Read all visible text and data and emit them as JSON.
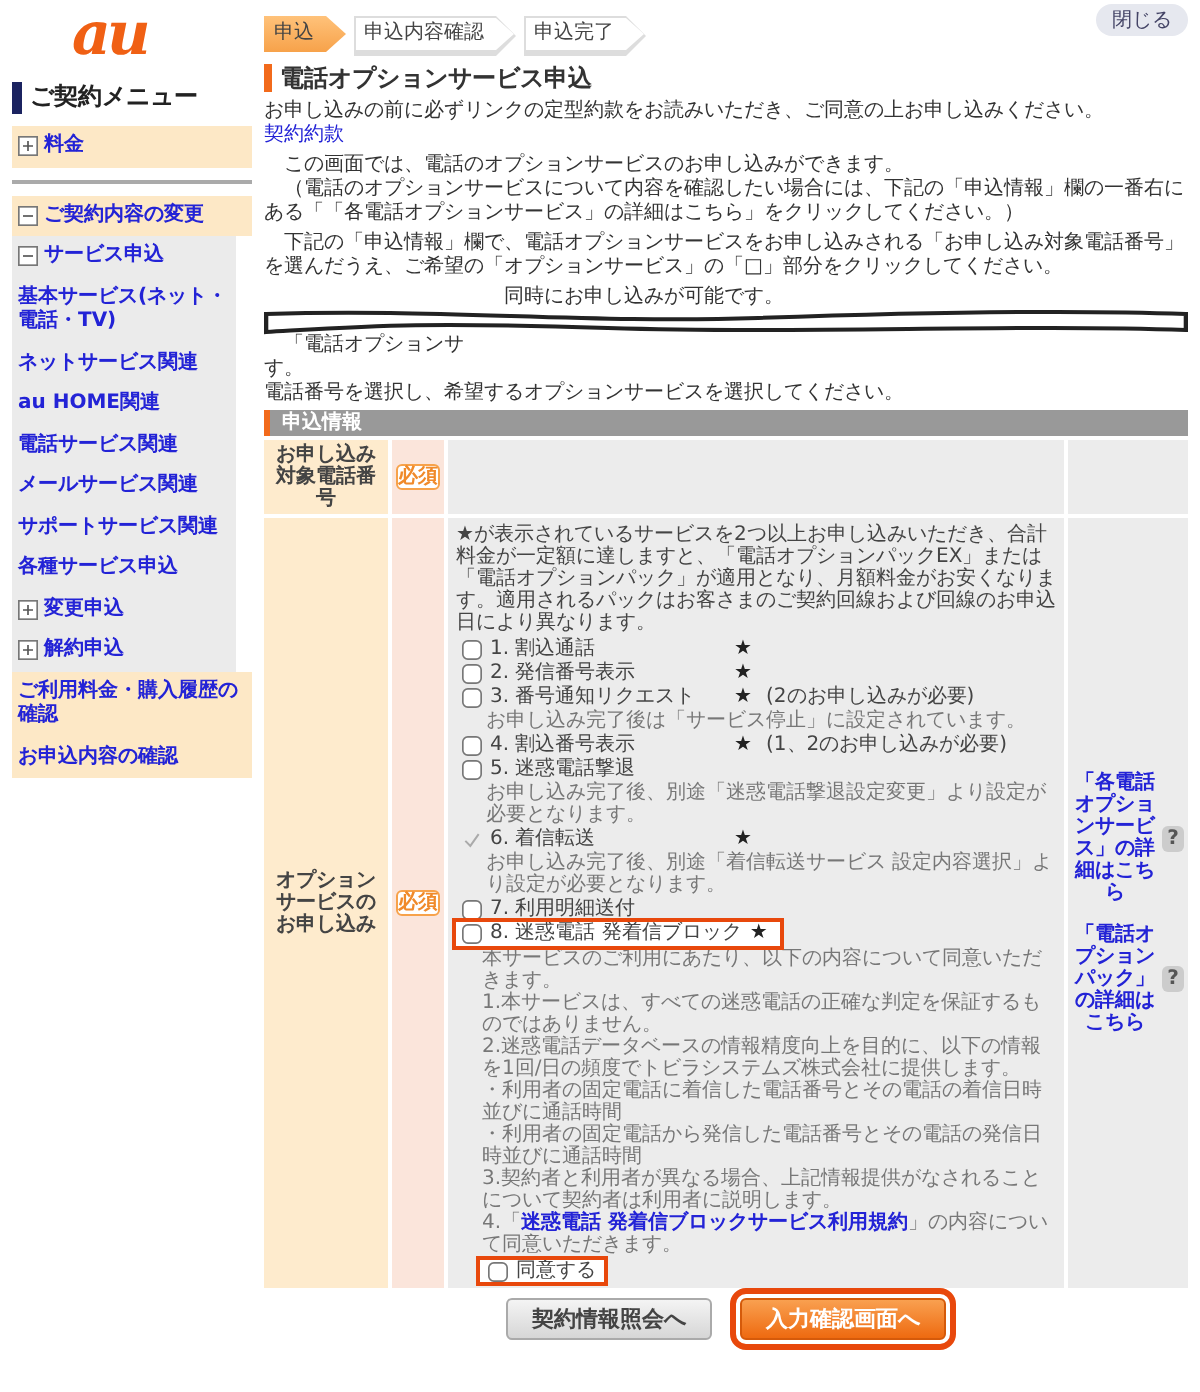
{
  "header": {
    "logo": "au",
    "close_button": "閉じる"
  },
  "sidebar": {
    "title": "ご契約メニュー",
    "items": [
      {
        "label": "料金",
        "kind": "group",
        "expanded": false
      },
      {
        "label": "ご契約内容の変更",
        "kind": "group",
        "expanded": true,
        "children": [
          {
            "label": "サービス申込",
            "kind": "group",
            "expanded": true,
            "children": [
              {
                "label": "基本サービス(ネット・電話・TV)",
                "kind": "link"
              },
              {
                "label": "ネットサービス関連",
                "kind": "link"
              },
              {
                "label": "au HOME関連",
                "kind": "link"
              },
              {
                "label": "電話サービス関連",
                "kind": "link"
              },
              {
                "label": "メールサービス関連",
                "kind": "link"
              },
              {
                "label": "サポートサービス関連",
                "kind": "link"
              },
              {
                "label": "各種サービス申込",
                "kind": "link"
              }
            ]
          },
          {
            "label": "変更申込",
            "kind": "group",
            "expanded": false
          },
          {
            "label": "解約申込",
            "kind": "group",
            "expanded": false
          }
        ]
      },
      {
        "label": "ご利用料金・購入履歴の確認",
        "kind": "link"
      },
      {
        "label": "お申込内容の確認",
        "kind": "link"
      }
    ]
  },
  "steps": [
    {
      "label": "申込",
      "selected": true
    },
    {
      "label": "申込内容確認",
      "selected": false
    },
    {
      "label": "申込完了",
      "selected": false
    }
  ],
  "page_title": "電話オプションサービス申込",
  "intro": {
    "text": "お申し込みの前に必ずリンクの定型約款をお読みいただき、ご同意の上お申し込みください。",
    "link": "契約約款"
  },
  "paragraphs": [
    [
      "この画面では、電話のオプションサービスのお申し込みができます。",
      "（電話のオプションサービスについて内容を確認したい場合には、下記の「申込情報」欄の一番右にある「「各電話オプションサービス」の詳細はこちら」をクリックしてください。）"
    ],
    [
      "下記の「申込情報」欄で、電話オプションサービスをお申し込みされる「お申し込み対象電話番号」を選んだうえ、ご希望の「オプションサービス」の「□」部分をクリックしてください。"
    ]
  ],
  "torn_fragments": [
    "同時にお申し込みが可能です。",
    "「電話オプションサ",
    "す。"
  ],
  "instruction": "電話番号を選択し、希望するオプションサービスを選択してください。",
  "form": {
    "title": "申込情報",
    "phone_row": {
      "label": "お申し込み対象電話番号",
      "required": "必須"
    },
    "options_row": {
      "label": "オプションサービスのお申し込み",
      "required": "必須",
      "description": "★が表示されているサービスを2つ以上お申し込みいただき、合計料金が一定額に達しますと、「電話オプションパックEX」または「電話オプションパック」が適用となり、月額料金がお安くなります。適用されるパックはお客さまのご契約回線および回線のお申込日により異なります。",
      "options": [
        {
          "kind": "checkbox",
          "checked": false,
          "highlighted": false,
          "label": "1. 割込通話",
          "star": "★"
        },
        {
          "kind": "checkbox",
          "checked": false,
          "highlighted": false,
          "label": "2. 発信番号表示",
          "star": "★"
        },
        {
          "kind": "checkbox",
          "checked": false,
          "highlighted": false,
          "label": "3. 番号通知リクエスト",
          "star": "★",
          "condition": "(2のお申し込みが必要)",
          "note": "お申し込み完了後は「サービス停止」に設定されています。"
        },
        {
          "kind": "checkbox",
          "checked": false,
          "highlighted": false,
          "label": "4. 割込番号表示",
          "star": "★",
          "condition": "(1、2のお申し込みが必要)"
        },
        {
          "kind": "checkbox",
          "checked": false,
          "highlighted": false,
          "label": "5. 迷惑電話撃退",
          "note": "お申し込み完了後、別途「迷惑電話撃退設定変更」より設定が必要となります。"
        },
        {
          "kind": "tick",
          "highlighted": false,
          "label": "6. 着信転送",
          "star": "★",
          "note": "お申し込み完了後、別途「着信転送サービス 設定内容選択」より設定が必要となります。"
        },
        {
          "kind": "checkbox",
          "checked": false,
          "highlighted": false,
          "label": "7. 利用明細送付"
        },
        {
          "kind": "checkbox",
          "checked": false,
          "highlighted": true,
          "label": "8. 迷惑電話 発着信ブロック",
          "star": "★"
        }
      ],
      "terms": [
        {
          "text": "本サービスのご利用にあたり、以下の内容について同意いただきます。"
        },
        {
          "text": "1.本サービスは、すべての迷惑電話の正確な判定を保証するものではありません。"
        },
        {
          "text": "2.迷惑電話データベースの情報精度向上を目的に、以下の情報を1回/日の頻度でトビラシステムズ株式会社に提供します。"
        },
        {
          "text": "・利用者の固定電話に着信した電話番号とその電話の着信日時並びに通話時間"
        },
        {
          "text": "・利用者の固定電話から発信した電話番号とその電話の発信日時並びに通話時間"
        },
        {
          "text": "3.契約者と利用者が異なる場合、上記情報提供がなされることについて契約者は利用者に説明します。"
        },
        {
          "text": "4.「",
          "link": "迷惑電話 発着信ブロックサービス利用規約",
          "after": "」の内容について同意いただきます。"
        }
      ],
      "agree": {
        "label": "同意する",
        "checked": false,
        "highlighted": true
      },
      "help_links": [
        {
          "text": "「各電話オプションサービス」の詳細はこちら",
          "help": "?"
        },
        {
          "text": "「電話オプションパック」の詳細はこちら",
          "help": "?"
        }
      ]
    }
  },
  "buttons": [
    {
      "label": "契約情報照会へ",
      "kind": "secondary",
      "highlighted": false
    },
    {
      "label": "入力確認画面へ",
      "kind": "primary",
      "highlighted": true
    }
  ]
}
